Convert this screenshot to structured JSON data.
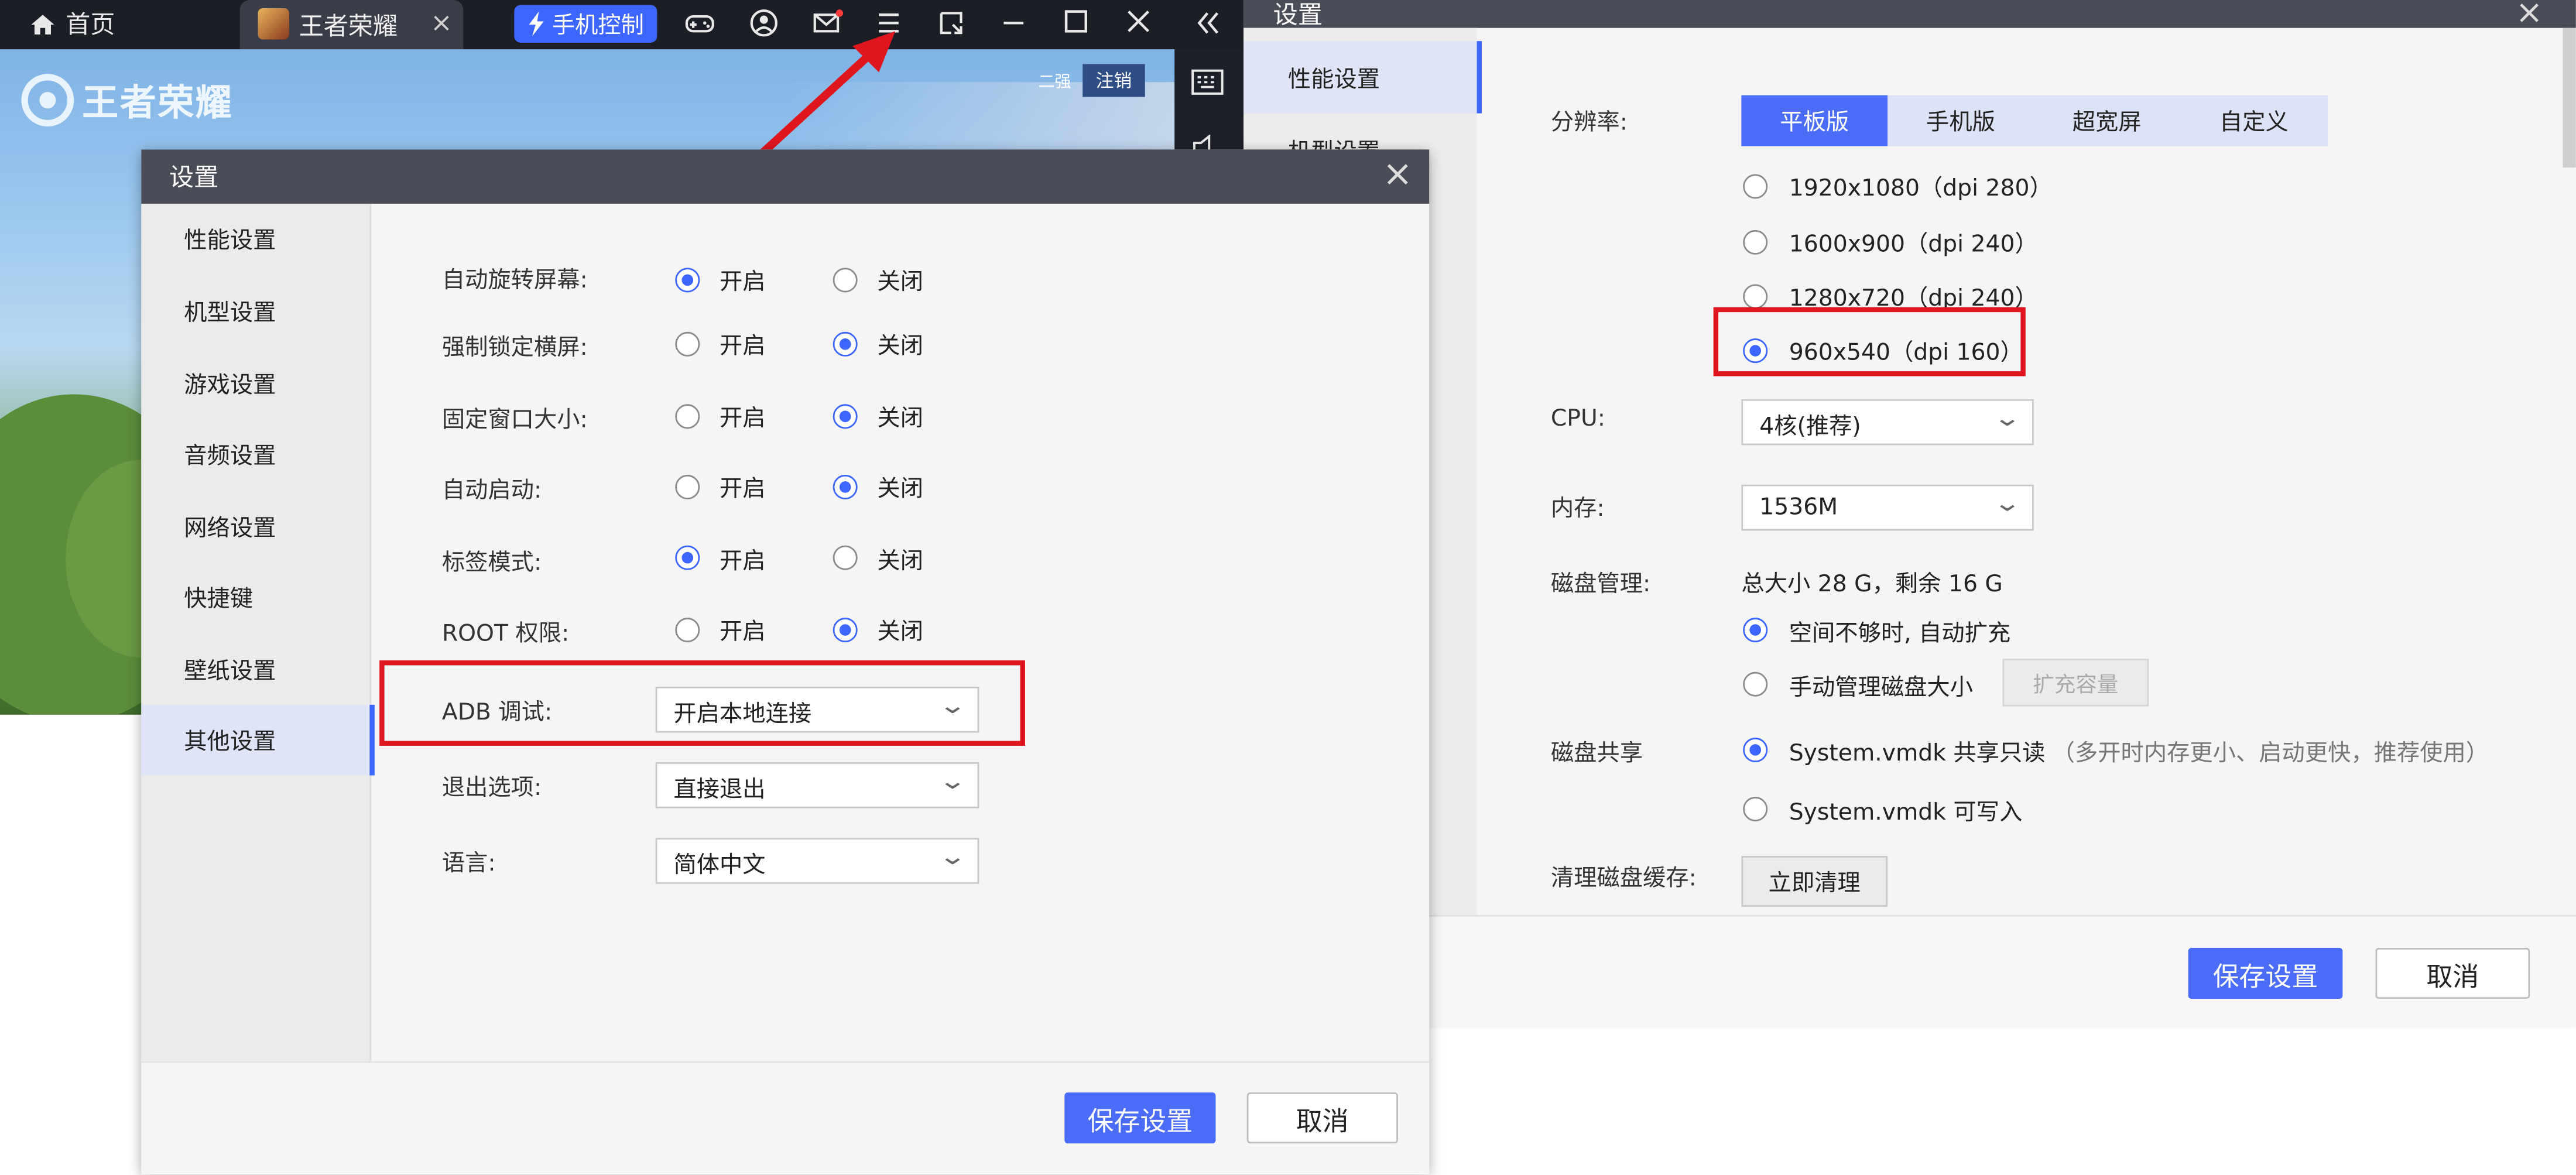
{
  "emulator": {
    "home_label": "首页",
    "tab_label": "王者荣耀",
    "tab_close": "×",
    "phone_control_label": "手机控制",
    "game_logo_text": "王者荣耀",
    "game_badge_left": "二强",
    "game_badge_right": "注销"
  },
  "left_dialog": {
    "title": "设置",
    "close": "×",
    "sidebar": [
      {
        "label": "性能设置"
      },
      {
        "label": "机型设置"
      },
      {
        "label": "游戏设置"
      },
      {
        "label": "音频设置"
      },
      {
        "label": "网络设置"
      },
      {
        "label": "快捷键"
      },
      {
        "label": "壁纸设置"
      },
      {
        "label": "其他设置"
      }
    ],
    "options": [
      {
        "label": "自动旋转屏幕:",
        "on": "开启",
        "off": "关闭",
        "selected": "on"
      },
      {
        "label": "强制锁定横屏:",
        "on": "开启",
        "off": "关闭",
        "selected": "off"
      },
      {
        "label": "固定窗口大小:",
        "on": "开启",
        "off": "关闭",
        "selected": "off"
      },
      {
        "label": "自动启动:",
        "on": "开启",
        "off": "关闭",
        "selected": "off"
      },
      {
        "label": "标签模式:",
        "on": "开启",
        "off": "关闭",
        "selected": "on"
      },
      {
        "label": "ROOT 权限:",
        "on": "开启",
        "off": "关闭",
        "selected": "off"
      }
    ],
    "adb_label": "ADB 调试:",
    "adb_value": "开启本地连接",
    "exit_label": "退出选项:",
    "exit_value": "直接退出",
    "lang_label": "语言:",
    "lang_value": "简体中文",
    "save_label": "保存设置",
    "cancel_label": "取消"
  },
  "right_panel": {
    "title": "设置",
    "close": "×",
    "sidebar_active": "性能设置",
    "sidebar_partial": "机型设置",
    "resolution_label": "分辨率:",
    "resolution_tabs": [
      "平板版",
      "手机版",
      "超宽屏",
      "自定义"
    ],
    "resolution_options": [
      {
        "label": "1920x1080（dpi 280）",
        "selected": false
      },
      {
        "label": "1600x900（dpi 240）",
        "selected": false
      },
      {
        "label": "1280x720（dpi 240）",
        "selected": false
      },
      {
        "label": "960x540（dpi 160）",
        "selected": true
      }
    ],
    "cpu_label": "CPU:",
    "cpu_value": "4核(推荐)",
    "memory_label": "内存:",
    "memory_value": "1536M",
    "disk_label": "磁盘管理:",
    "disk_info": "总大小 28 G，剩余 16 G",
    "disk_auto": "空间不够时, 自动扩充",
    "disk_manual": "手动管理磁盘大小",
    "expand_button": "扩充容量",
    "share_label": "磁盘共享",
    "share_readonly": "System.vmdk 共享只读",
    "share_readonly_note": "（多开时内存更小、启动更快，推荐使用）",
    "share_writable": "System.vmdk 可写入",
    "clean_label": "清理磁盘缓存:",
    "clean_button": "立即清理",
    "save_label": "保存设置",
    "cancel_label": "取消"
  },
  "colors": {
    "accent": "#4b6cf7",
    "highlight_box": "#e0161e",
    "titlebar": "#4a4d57"
  }
}
